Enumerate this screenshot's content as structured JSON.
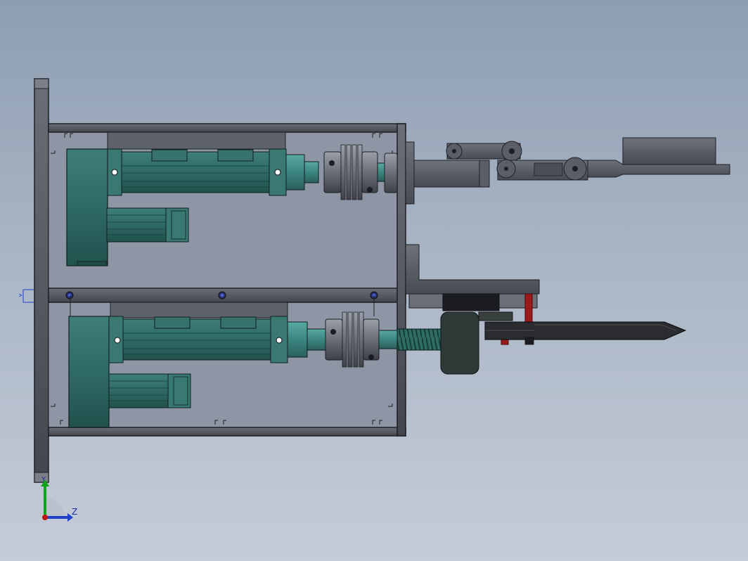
{
  "view": {
    "triad": {
      "y_axis_label": "Y",
      "z_axis_label": "Z"
    },
    "colors": {
      "background_top": "#8e9db2",
      "background_bottom": "#c4ccd7",
      "frame": "#4d5058",
      "frame_edge": "#1e1f24",
      "panel": "#8c94a3",
      "motor": "#2f6a65",
      "motor_dark": "#1f4a47",
      "coupling": "#6a6e78",
      "arm": "#555a62",
      "blade": "#2b2c30",
      "red_pin": "#9b1a1a",
      "axis_x": "#c21414",
      "axis_y": "#12a21c",
      "axis_z": "#1f3fc7"
    }
  }
}
